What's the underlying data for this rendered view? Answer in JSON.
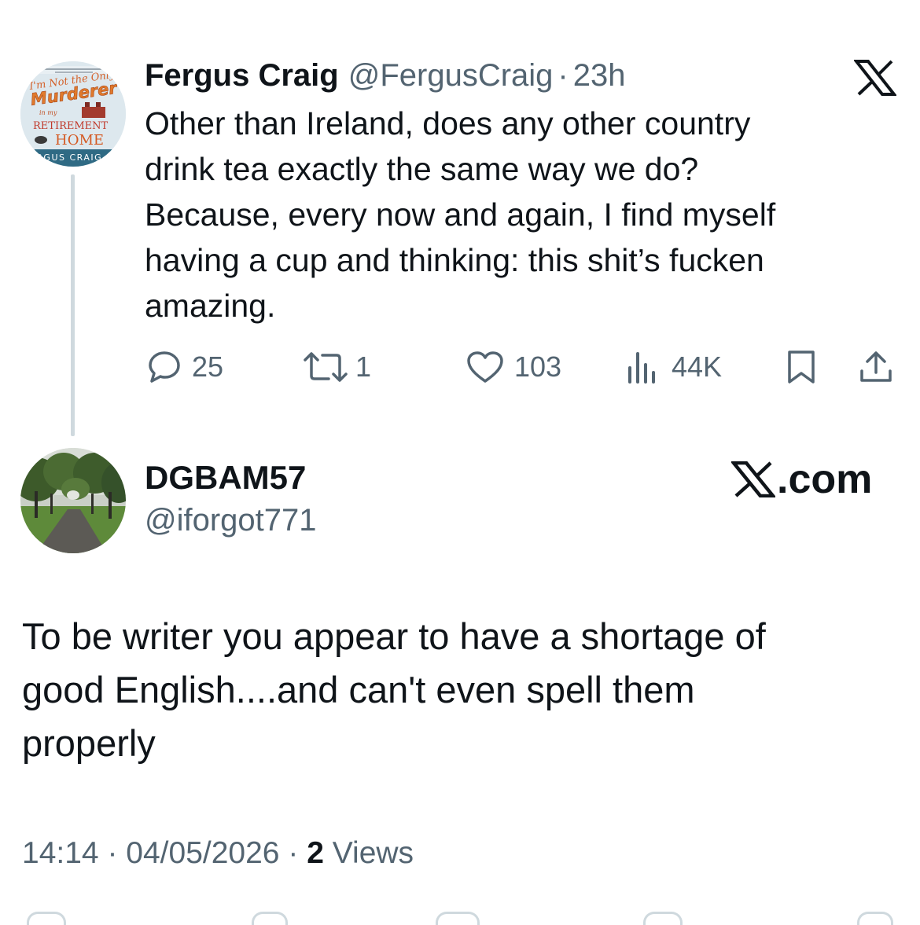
{
  "parent_tweet": {
    "author_name": "Fergus Craig",
    "author_handle": "@FergusCraig",
    "separator": "·",
    "time_ago": "23h",
    "avatar": {
      "type": "book-cover",
      "lines": [
        "I'm Not the Only",
        "Murderer",
        "in my",
        "RETIREMENT",
        "HOME",
        "FERGUS CRAIG"
      ]
    },
    "text_lines": [
      "Other than Ireland, does any other country",
      "drink tea exactly the same way we do?",
      "Because, every now and again, I find myself",
      "having a cup and thinking: this shit’s fucken",
      "amazing."
    ],
    "actions": {
      "replies": "25",
      "reposts": "1",
      "likes": "103",
      "views": "44K"
    }
  },
  "reply_tweet": {
    "author_name": "DGBAM57",
    "author_handle": "@iforgot771",
    "avatar": {
      "type": "photo",
      "subject": "tree-lined park path"
    },
    "brand_label": ".com",
    "text_lines": [
      "To be writer you appear to have a shortage of",
      "good English....and can't even spell them",
      "properly"
    ],
    "time": "14:14",
    "separator": "·",
    "date": "04/05/2026",
    "views_count": "2",
    "views_label": "Views"
  },
  "icons": {
    "close": "x-logo-icon",
    "reply": "reply-icon",
    "repost": "repost-icon",
    "like": "heart-icon",
    "views": "views-icon",
    "bookmark": "bookmark-icon",
    "share": "share-icon"
  },
  "colors": {
    "text_primary": "#0f1419",
    "text_secondary": "#536471",
    "thread_line": "#cfd9de",
    "background": "#ffffff"
  }
}
